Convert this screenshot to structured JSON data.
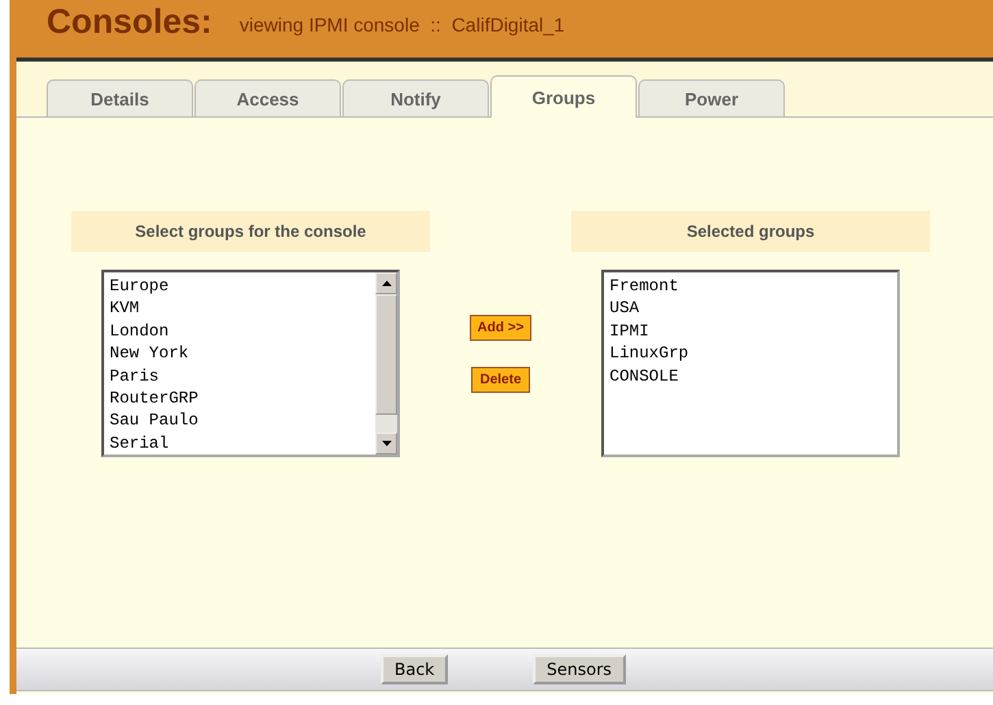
{
  "header": {
    "title": "Consoles:",
    "subtitle": "viewing IPMI console  ::  CalifDigital_1"
  },
  "tabs": [
    {
      "label": "Details",
      "selected": false
    },
    {
      "label": "Access",
      "selected": false
    },
    {
      "label": "Notify",
      "selected": false
    },
    {
      "label": "Groups",
      "selected": true
    },
    {
      "label": "Power",
      "selected": false
    }
  ],
  "available": {
    "heading": "Select groups for the console",
    "items": [
      "Europe",
      "KVM",
      "London",
      "New York",
      "Paris",
      "RouterGRP",
      "Sau Paulo",
      "Serial"
    ]
  },
  "actions": [
    "Add >>",
    "Delete"
  ],
  "selected": {
    "heading": "Selected groups",
    "items": [
      "Fremont",
      "USA",
      "IPMI",
      "LinuxGrp",
      "CONSOLE"
    ]
  },
  "footer_buttons": [
    "Back",
    "Sensors"
  ]
}
